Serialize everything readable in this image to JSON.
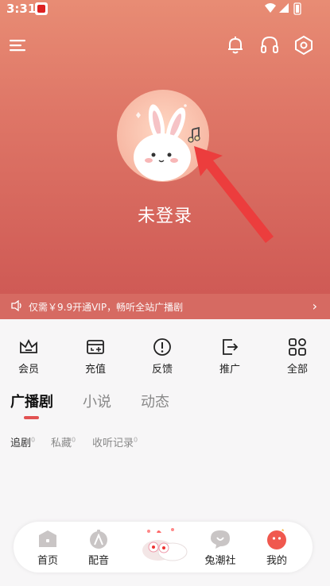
{
  "status": {
    "time": "3:31"
  },
  "profile": {
    "login_label": "未登录"
  },
  "vip": {
    "text": "仅需￥9.9开通VIP，畅听全站广播剧"
  },
  "shortcuts": [
    {
      "label": "会员",
      "icon": "crown-icon"
    },
    {
      "label": "充值",
      "icon": "wallet-icon"
    },
    {
      "label": "反馈",
      "icon": "exclamation-circle-icon"
    },
    {
      "label": "推广",
      "icon": "share-exit-icon"
    },
    {
      "label": "全部",
      "icon": "grid-icon"
    }
  ],
  "tabs": [
    {
      "label": "广播剧",
      "active": true
    },
    {
      "label": "小说"
    },
    {
      "label": "动态"
    }
  ],
  "subtabs": [
    {
      "label": "追剧",
      "count": "0"
    },
    {
      "label": "私藏",
      "count": "0"
    },
    {
      "label": "收听记录",
      "count": "0"
    }
  ],
  "nav": [
    {
      "label": "首页",
      "icon": "home-icon"
    },
    {
      "label": "配音",
      "icon": "mic-icon"
    },
    {
      "label": "",
      "icon": "mascot-icon"
    },
    {
      "label": "兔潮社",
      "icon": "community-icon"
    },
    {
      "label": "我的",
      "icon": "profile-icon"
    }
  ],
  "colors": {
    "accent": "#e25252",
    "hero_top": "#e88c74",
    "hero_bottom": "#cf5a55"
  }
}
